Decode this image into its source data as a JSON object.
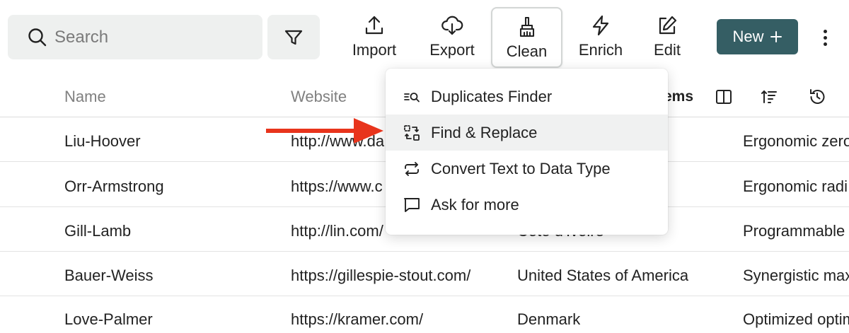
{
  "toolbar": {
    "search_placeholder": "Search",
    "buttons": [
      {
        "label": "Import",
        "icon": "upload-icon"
      },
      {
        "label": "Export",
        "icon": "cloud-download-icon"
      },
      {
        "label": "Clean",
        "icon": "broom-icon"
      },
      {
        "label": "Enrich",
        "icon": "lightning-icon"
      },
      {
        "label": "Edit",
        "icon": "edit-icon"
      }
    ],
    "new_label": "New",
    "new_color": "#355e64"
  },
  "table": {
    "headers": [
      "Name",
      "Website"
    ],
    "header_partial": "ems",
    "rows": [
      {
        "name": "Liu-Hoover",
        "website": "http://www.da",
        "country": "",
        "description": "Ergonomic zero"
      },
      {
        "name": "Orr-Armstrong",
        "website": "https://www.c",
        "country": "",
        "description": "Ergonomic radi"
      },
      {
        "name": "Gill-Lamb",
        "website": "http://lin.com/",
        "country": "Cote d'Ivoire",
        "description": "Programmable"
      },
      {
        "name": "Bauer-Weiss",
        "website": "https://gillespie-stout.com/",
        "country": "United States of America",
        "description": "Synergistic max"
      },
      {
        "name": "Love-Palmer",
        "website": "https://kramer.com/",
        "country": "Denmark",
        "description": "Optimized optim"
      }
    ]
  },
  "clean_menu": {
    "items": [
      {
        "label": "Duplicates Finder",
        "icon": "duplicates-search-icon"
      },
      {
        "label": "Find & Replace",
        "icon": "find-replace-icon"
      },
      {
        "label": "Convert Text to Data Type",
        "icon": "convert-arrows-icon"
      },
      {
        "label": "Ask for more",
        "icon": "chat-bubble-icon"
      }
    ],
    "highlighted_index": 1
  },
  "annotation": {
    "arrow_color": "#e8341c"
  }
}
